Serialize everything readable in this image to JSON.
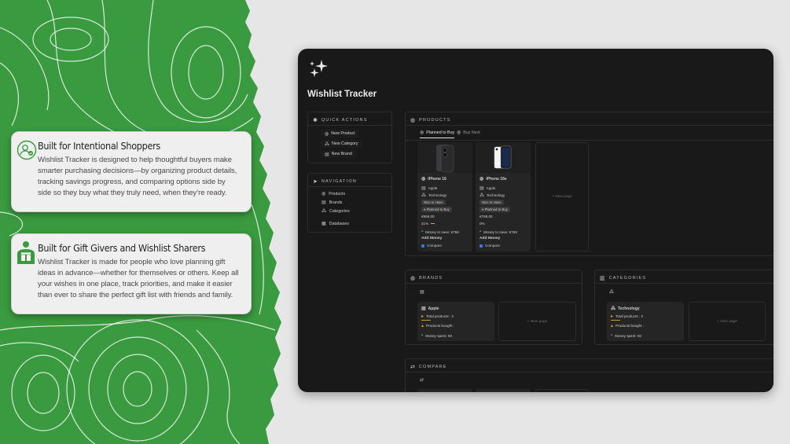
{
  "features": [
    {
      "title": "Built for Intentional Shoppers",
      "description": "Wishlist Tracker is designed to help thoughtful buyers make smarter purchasing decisions—by organizing product details, tracking savings progress, and comparing options side by side so they buy what they truly need, when they’re ready.",
      "icon": "user-check-icon"
    },
    {
      "title": "Built for Gift Givers and Wishlist Sharers",
      "description": "Wishlist Tracker is made for people who love planning gift ideas in advance—whether for themselves or others. Keep all your wishes in one place, track priorities, and make it easier than ever to share the perfect gift list with friends and family.",
      "icon": "gift-person-icon"
    }
  ],
  "colors": {
    "green": "#3a9a3f",
    "card_bg": "#efefef",
    "app_bg": "#191919",
    "accent_check": "#2f7be0"
  },
  "app": {
    "title": "Wishlist Tracker",
    "quick_actions": {
      "heading": "QUICK ACTIONS",
      "buttons": [
        "New Product",
        "New Category",
        "New Brand"
      ]
    },
    "navigation": {
      "heading": "NAVIGATION",
      "items": [
        "Products",
        "Brands",
        "Categories",
        "Databases"
      ]
    },
    "products": {
      "heading": "PRODUCTS",
      "tabs": [
        "Planned to Buy",
        "Buy Next"
      ],
      "active_tab": "Planned to Buy",
      "new_page": "New page",
      "cards": [
        {
          "name": "iPhone 16",
          "brand": "Apple",
          "category": "Technology",
          "priority": "Nice to Have",
          "status": "Planned to Buy",
          "price": "€959,00",
          "progress": "21%",
          "progress_value": 0.21,
          "saving": "Money to save: €758",
          "action": "Add Money",
          "compare": "Compare"
        },
        {
          "name": "iPhone 16e",
          "brand": "Apple",
          "category": "Technology",
          "priority": "Nice to Have",
          "status": "Planned to Buy",
          "price": "€789,00",
          "progress": "0%",
          "progress_value": 0,
          "saving": "Money to save: €789",
          "action": "Add Money",
          "compare": "Compare"
        }
      ]
    },
    "brands": {
      "heading": "BRANDS",
      "new_page": "New page",
      "card": {
        "name": "Apple",
        "total": "Total products : 2",
        "bought": "Products bought :",
        "spent": "Money spent: €0"
      }
    },
    "categories": {
      "heading": "CATEGORIES",
      "new_page": "New page",
      "card": {
        "name": "Technology",
        "total": "Total products : 2",
        "bought": "Products bought :",
        "spent": "Money spent: €0"
      }
    },
    "compare": {
      "heading": "COMPARE"
    }
  }
}
